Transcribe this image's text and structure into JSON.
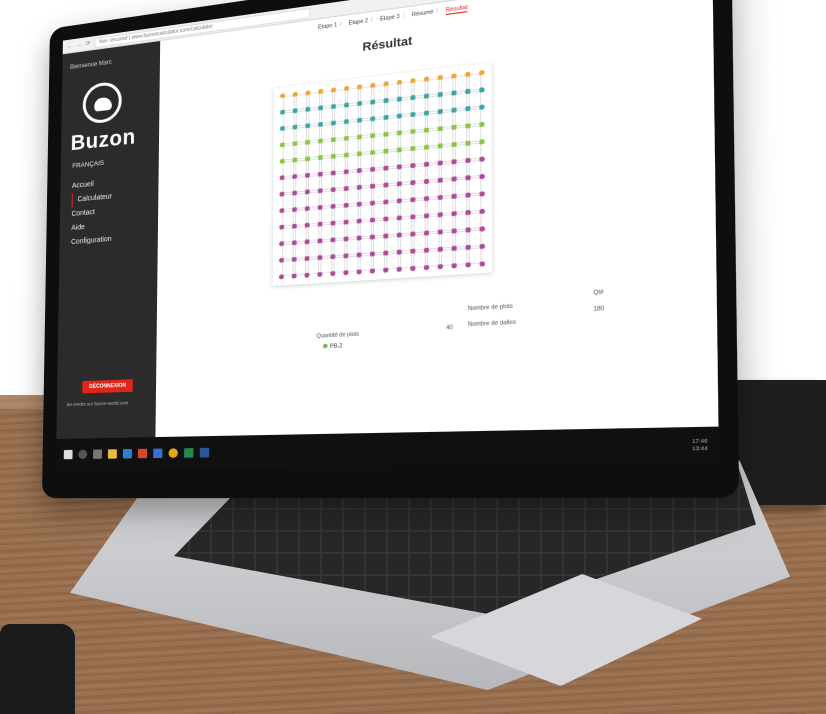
{
  "browser": {
    "url": "Non sécurisé | www.buzoncalculator.com/calculator"
  },
  "sidebar": {
    "greeting": "Bienvenue Marc",
    "logo_text": "Buzon",
    "language": "FRANÇAIS",
    "menu": [
      {
        "label": "Accueil",
        "active": false
      },
      {
        "label": "Calculateur",
        "active": true
      },
      {
        "label": "Contact",
        "active": false
      },
      {
        "label": "Aide",
        "active": false
      },
      {
        "label": "Configuration",
        "active": false
      }
    ],
    "logout_label": "DÉCONNEXION",
    "site_link": "Se rendre sur buzon-world.com"
  },
  "main": {
    "steps": [
      "Étape 1",
      "Étape 2",
      "Étape 3",
      "Résumé",
      "Résultat"
    ],
    "title": "Résultat",
    "grid": {
      "columns": 15,
      "rows": 11,
      "row_colors": [
        "#f0a637",
        "#3aa6a5",
        "#3aa6a5",
        "#8cc63f",
        "#8cc63f",
        "#b04a9c",
        "#b04a9c",
        "#b04a9c",
        "#b04a9c",
        "#b04a9c",
        "#b04a9c",
        "#b04a9c"
      ]
    },
    "summary": {
      "qty_label": "Quantité de plots",
      "qty_value": "PB-2",
      "row1_label": "Nombre de plots",
      "row1_value": "Qté",
      "row2_number": "40",
      "row2_label": "Nombre de dalles",
      "row2_value": "180"
    }
  },
  "taskbar": {
    "time": "17:46",
    "date": "13:44"
  }
}
